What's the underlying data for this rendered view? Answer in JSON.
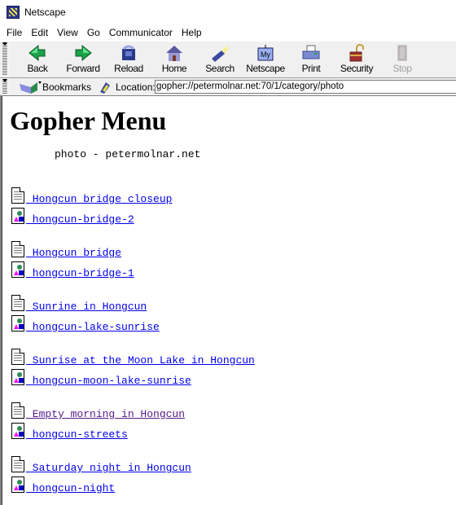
{
  "window": {
    "title": "Netscape",
    "icon": "netscape-icon"
  },
  "menu": [
    "File",
    "Edit",
    "View",
    "Go",
    "Communicator",
    "Help"
  ],
  "toolbar": {
    "buttons": [
      {
        "label": "Back",
        "icon": "back-arrow-icon",
        "enabled": true
      },
      {
        "label": "Forward",
        "icon": "forward-arrow-icon",
        "enabled": true
      },
      {
        "label": "Reload",
        "icon": "reload-icon",
        "enabled": true
      },
      {
        "label": "Home",
        "icon": "home-icon",
        "enabled": true
      },
      {
        "label": "Search",
        "icon": "search-flashlight-icon",
        "enabled": true
      },
      {
        "label": "Netscape",
        "icon": "my-netscape-icon",
        "enabled": true
      },
      {
        "label": "Print",
        "icon": "printer-icon",
        "enabled": true
      },
      {
        "label": "Security",
        "icon": "padlock-icon",
        "enabled": true
      },
      {
        "label": "Stop",
        "icon": "stop-icon",
        "enabled": false
      }
    ]
  },
  "location_bar": {
    "bookmarks_label": "Bookmarks",
    "location_label": "Location:",
    "url": "gopher://petermolnar.net:70/1/category/photo"
  },
  "page": {
    "heading": "Gopher Menu",
    "subtitle": "photo - petermolnar.net",
    "colors": {
      "link": "#0000ee",
      "visited": "#551a8b"
    },
    "groups": [
      {
        "text": {
          "label": " Hongcun bridge closeup",
          "visited": false
        },
        "image": {
          "label": " hongcun-bridge-2",
          "visited": false
        }
      },
      {
        "text": {
          "label": " Hongcun bridge",
          "visited": false
        },
        "image": {
          "label": " hongcun-bridge-1",
          "visited": false
        }
      },
      {
        "text": {
          "label": " Sunrine in Hongcun",
          "visited": false
        },
        "image": {
          "label": " hongcun-lake-sunrise",
          "visited": false
        }
      },
      {
        "text": {
          "label": " Sunrise at the Moon Lake in Hongcun",
          "visited": false
        },
        "image": {
          "label": " hongcun-moon-lake-sunrise",
          "visited": false
        }
      },
      {
        "text": {
          "label": " Empty morning in Hongcun",
          "visited": true
        },
        "image": {
          "label": " hongcun-streets",
          "visited": false
        }
      },
      {
        "text": {
          "label": " Saturday night in Hongcun",
          "visited": false
        },
        "image": {
          "label": " hongcun-night",
          "visited": false
        }
      }
    ]
  }
}
